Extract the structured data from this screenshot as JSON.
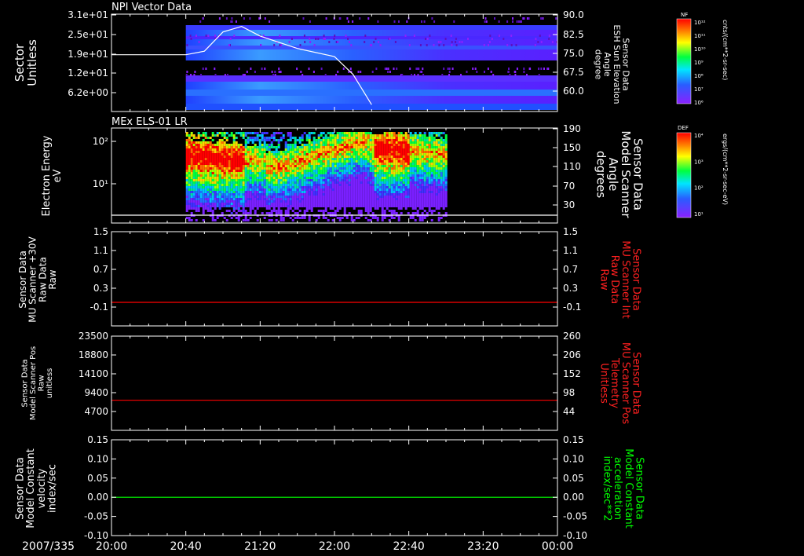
{
  "colors": {
    "frame": "#ffffff",
    "red": "#ff0000",
    "green": "#00ff00"
  },
  "time_axis": {
    "date": "2007/335",
    "ticks": [
      "20:00",
      "20:40",
      "21:20",
      "22:00",
      "22:40",
      "23:20",
      "00:00"
    ]
  },
  "chart_data": [
    {
      "type": "heatmap",
      "title": "NPI Vector Data",
      "ylabel": [
        "Sector",
        "Unitless"
      ],
      "yticks": [
        "3.1e+01",
        "2.5e+01",
        "1.9e+01",
        "1.2e+01",
        "6.2e+00"
      ],
      "y2label": [
        "Sensor Data",
        "ESH Sun Elevation",
        "Angle",
        "degree"
      ],
      "y2ticks": [
        "90.0",
        "82.5",
        "75.0",
        "67.5",
        "60.0"
      ],
      "y2lim": [
        54.5,
        90.0
      ],
      "data_start": "20:40",
      "overlay_line": {
        "x": [
          "20:00",
          "20:30",
          "20:40",
          "20:50",
          "21:00",
          "21:10",
          "21:20",
          "21:40",
          "22:00",
          "22:10",
          "22:20"
        ],
        "y": [
          75.2,
          75.2,
          75.2,
          76.5,
          83.5,
          85.5,
          82,
          77.5,
          74.5,
          68,
          57
        ]
      },
      "colorbar": {
        "label": "NF",
        "unit": "cnts/(cm**2-sr-sec)",
        "ticks": [
          "10¹²",
          "10¹¹",
          "10¹⁰",
          "10⁹",
          "10⁸",
          "10⁷",
          "10⁶"
        ]
      }
    },
    {
      "type": "heatmap",
      "title": "MEx ELS-01 LR",
      "ylabel": [
        "Electron Energy",
        "eV"
      ],
      "yticks": [
        "10²",
        "10¹"
      ],
      "y2label": [
        "Sensor Data",
        "Model Scanner",
        "Angle",
        "degrees"
      ],
      "y2ticks": [
        "190",
        "150",
        "110",
        "70",
        "30"
      ],
      "data_range": [
        "20:40",
        "23:00"
      ],
      "overlay_line": {
        "x": [
          "20:00",
          "00:00"
        ],
        "y": [
          12,
          12
        ]
      },
      "colorbar": {
        "label": "DEF",
        "unit": "ergs/(cm**2-sr-sec-eV)",
        "ticks": [
          "10⁴",
          "10³",
          "10²",
          "10¹"
        ]
      }
    },
    {
      "type": "line",
      "ylabel": [
        "Sensor Data",
        "MU Scanner +30V",
        "Raw Data",
        "Raw"
      ],
      "yticks": [
        "1.5",
        "1.1",
        "0.7",
        "0.3",
        "-0.1"
      ],
      "ylim": [
        -0.5,
        1.5
      ],
      "y2label": [
        "Sensor Data",
        "MU Scanner Int",
        "Raw Data",
        "Raw"
      ],
      "y2ticks": [
        "1.5",
        "1.1",
        "0.7",
        "0.3",
        "-0.1"
      ],
      "series": [
        {
          "x": [
            "20:00",
            "00:00"
          ],
          "y": [
            0,
            0
          ],
          "color": "#ff0000"
        }
      ]
    },
    {
      "type": "line",
      "ylabel": [
        "Sensor Data",
        "Model Scanner Pos",
        "Raw",
        "unitless"
      ],
      "yticks": [
        "23500",
        "18800",
        "14100",
        "9400",
        "4700"
      ],
      "ylim": [
        0,
        23500
      ],
      "y2label": [
        "Sensor Data",
        "MU Scanner Pos",
        "Telemetry",
        "Unitless"
      ],
      "y2ticks": [
        "260",
        "206",
        "152",
        "98",
        "44"
      ],
      "series": [
        {
          "x": [
            "20:00",
            "00:00"
          ],
          "y": [
            7500,
            7500
          ],
          "color": "#ff0000"
        }
      ]
    },
    {
      "type": "line",
      "ylabel": [
        "Sensor Data",
        "Model Constant",
        "velocity",
        "index/sec"
      ],
      "yticks": [
        "0.15",
        "0.10",
        "0.05",
        "0.00",
        "-0.05",
        "-0.10"
      ],
      "ylim": [
        -0.1,
        0.15
      ],
      "y2label": [
        "Sensor Data",
        "Model Constant",
        "acceleration",
        "index/sec**2"
      ],
      "y2ticks": [
        "0.15",
        "0.10",
        "0.05",
        "0.00",
        "-0.05",
        "-0.10"
      ],
      "series": [
        {
          "x": [
            "20:00",
            "00:00"
          ],
          "y": [
            0,
            0
          ],
          "color": "#00ff00"
        }
      ]
    }
  ]
}
